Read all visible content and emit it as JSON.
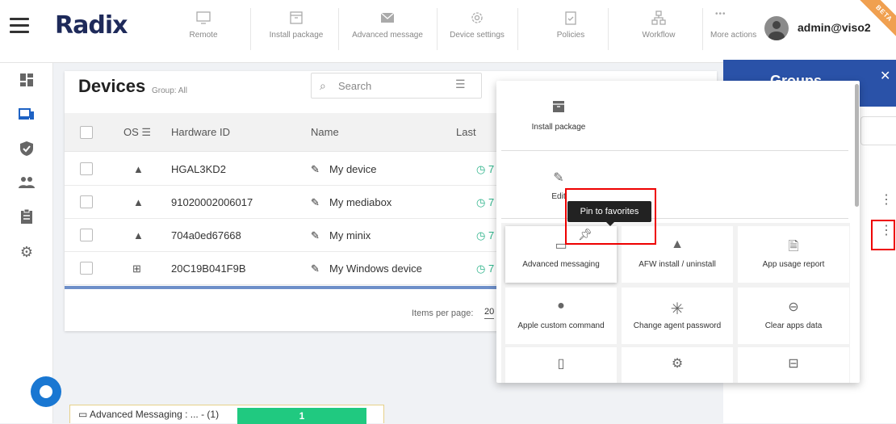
{
  "header": {
    "logo": "Radix",
    "toolbar": [
      {
        "label": "Remote",
        "icon": "monitor-icon"
      },
      {
        "label": "Install package",
        "icon": "package-icon"
      },
      {
        "label": "Advanced message",
        "icon": "envelope-icon"
      },
      {
        "label": "Device settings",
        "icon": "gear-icon"
      },
      {
        "label": "Policies",
        "icon": "clipboard-icon"
      },
      {
        "label": "Workflow",
        "icon": "workflow-icon"
      },
      {
        "label": "More actions",
        "icon": "more-dots-icon"
      }
    ],
    "user": "admin@viso2",
    "beta": "BETA"
  },
  "sidebar": [
    "dashboard-icon",
    "devices-icon",
    "shield-icon",
    "users-icon",
    "clipboard-icon",
    "gear-icon"
  ],
  "devices": {
    "title": "Devices",
    "group": "Group: All",
    "search_placeholder": "Search",
    "columns": {
      "os": "OS",
      "hardware_id": "Hardware ID",
      "name": "Name",
      "last": "Last"
    },
    "rows": [
      {
        "os": "android",
        "hardware_id": "HGAL3KD2",
        "name": "My device",
        "last": "7"
      },
      {
        "os": "android",
        "hardware_id": "91020002006017",
        "name": "My mediabox",
        "last": "7"
      },
      {
        "os": "android",
        "hardware_id": "704a0ed67668",
        "name": "My minix",
        "last": "7"
      },
      {
        "os": "windows",
        "hardware_id": "20C19B041F9B",
        "name": "My Windows device",
        "last": "7"
      }
    ],
    "items_per_page_label": "Items per page:",
    "items_per_page": "20"
  },
  "groups": {
    "title": "Groups"
  },
  "popup": {
    "install_package": "Install package",
    "edit": "Edit",
    "tooltip": "Pin to favorites",
    "tiles": [
      {
        "label": "Advanced messaging",
        "icon": "message-icon"
      },
      {
        "label": "AFW install / uninstall",
        "icon": "android-icon"
      },
      {
        "label": "App usage report",
        "icon": "document-icon"
      },
      {
        "label": "Apple custom command",
        "icon": "apple-icon"
      },
      {
        "label": "Change agent password",
        "icon": "asterisk-icon"
      },
      {
        "label": "Clear apps data",
        "icon": "minus-circle-icon"
      }
    ]
  },
  "status": {
    "text": "Advanced Messaging : ... - (1)",
    "count": "1"
  },
  "colors": {
    "accent": "#2a52a8",
    "success": "#20c980",
    "highlight": "#e00000"
  }
}
